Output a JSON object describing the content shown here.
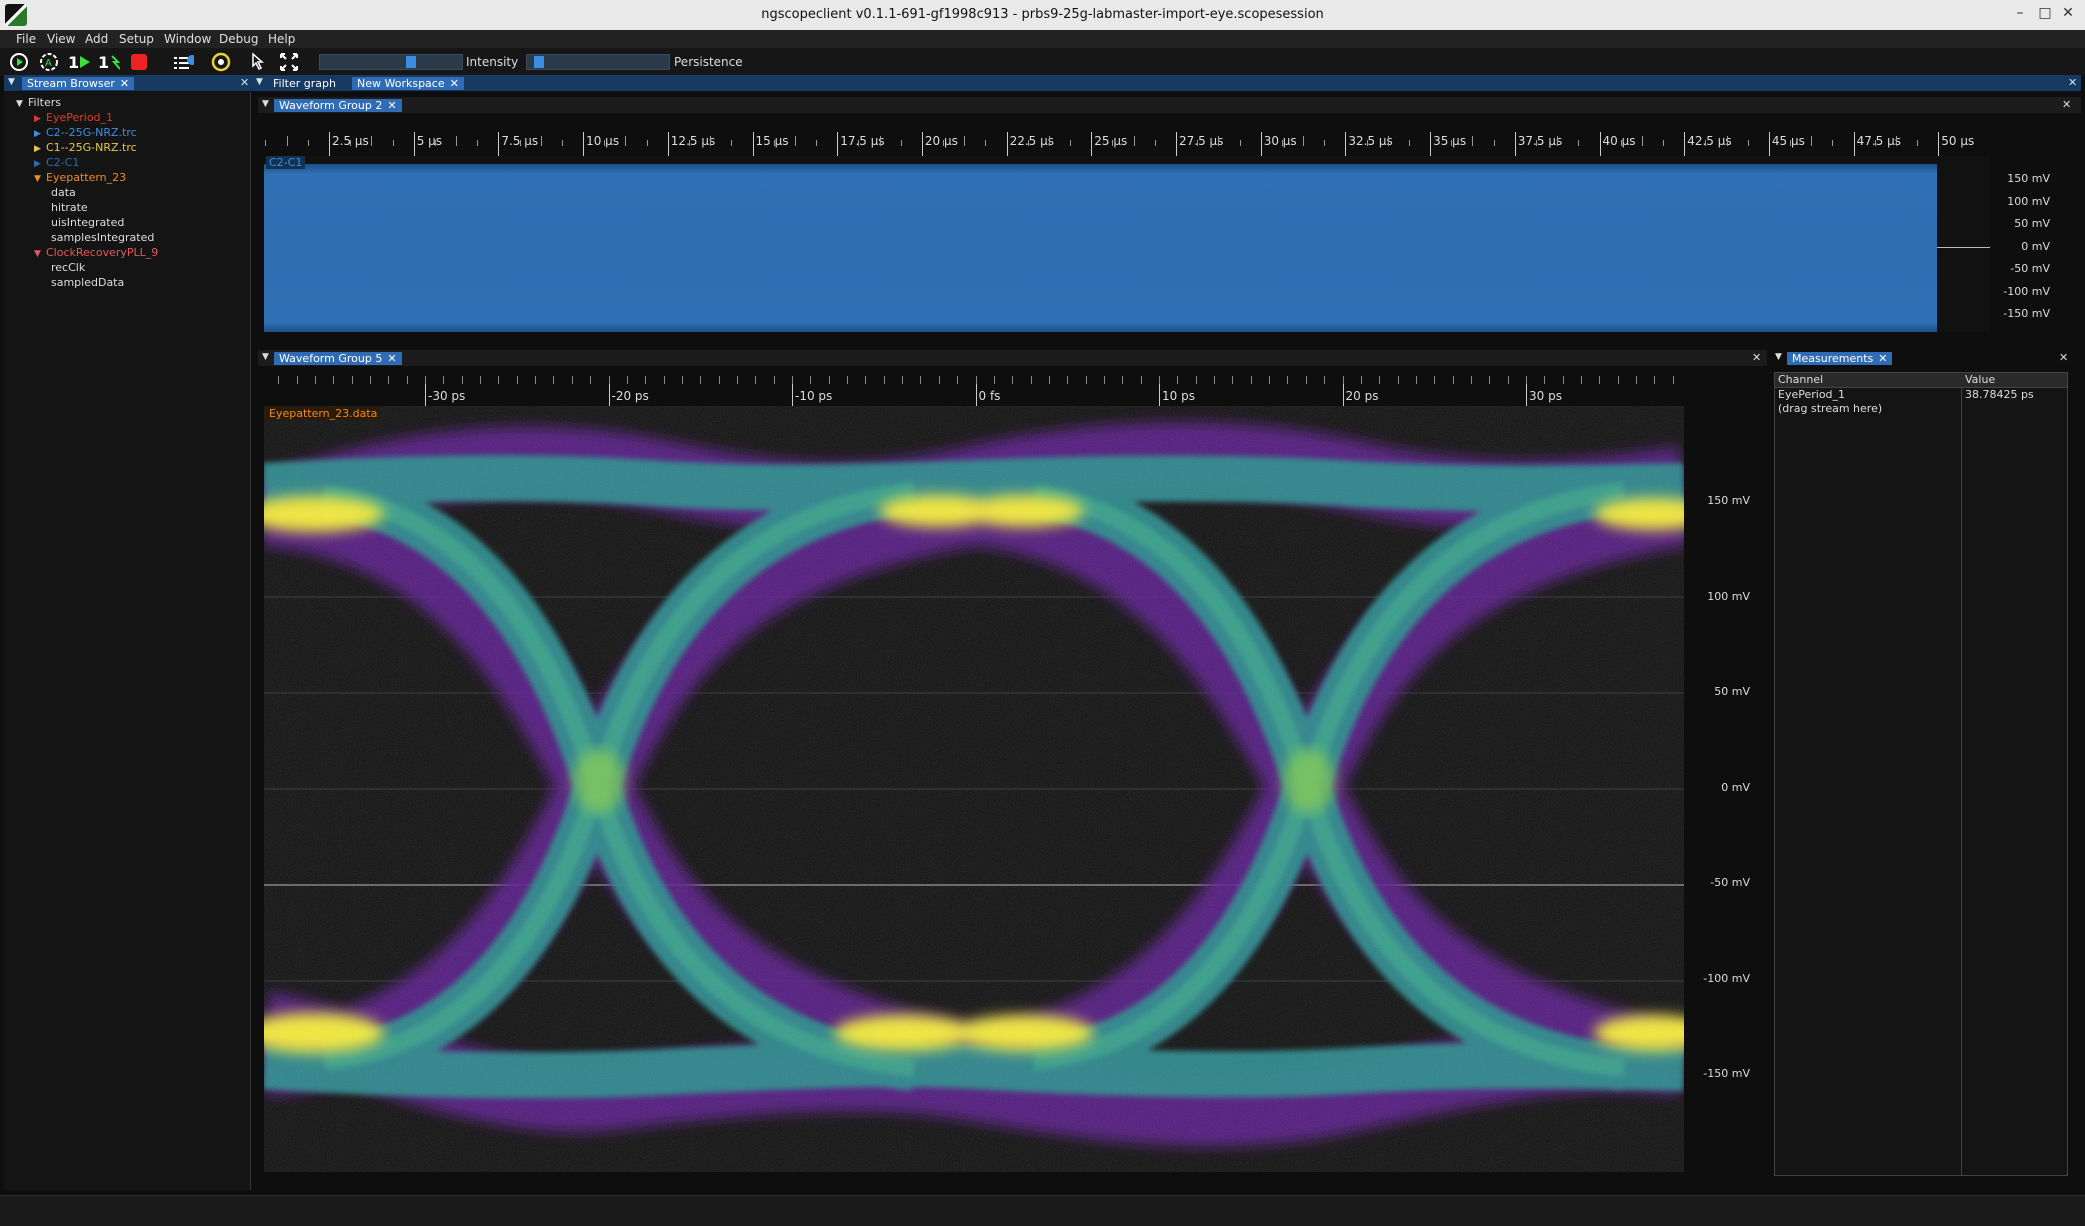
{
  "window": {
    "title": "ngscopeclient v0.1.1-691-gf1998c913  - prbs9-25g-labmaster-import-eye.scopesession",
    "controls": [
      "–",
      "□",
      "✕"
    ]
  },
  "menu": [
    "File",
    "View",
    "Add",
    "Setup",
    "Window",
    "Debug",
    "Help"
  ],
  "toolbar": {
    "intensity_label": "Intensity",
    "intensity_value": 0.65,
    "persistence_label": "Persistence",
    "persistence_value": 0.05,
    "icons": [
      "run-normal-icon",
      "run-auto-icon",
      "single-trigger-icon",
      "force-trigger-icon",
      "stop-icon",
      "timebase-icon",
      "trigger-settings-icon",
      "measure-cursor-icon",
      "fullscreen-icon"
    ]
  },
  "stream_browser": {
    "tab_label": "Stream Browser",
    "root": "Filters",
    "items": [
      {
        "label": "EyePeriod_1",
        "color": "#e03a2e",
        "expanded": false,
        "indent": 1
      },
      {
        "label": "C2--25G-NRZ.trc",
        "color": "#3d8fe0",
        "expanded": false,
        "indent": 1
      },
      {
        "label": "C1--25G-NRZ.trc",
        "color": "#e8c84a",
        "expanded": false,
        "indent": 1
      },
      {
        "label": "C2-C1",
        "color": "#2b6cb5",
        "expanded": false,
        "indent": 1
      },
      {
        "label": "Eyepattern_23",
        "color": "#f08a24",
        "expanded": true,
        "indent": 1
      },
      {
        "label": "data",
        "color": "#dddddd",
        "indent": 2
      },
      {
        "label": "hitrate",
        "color": "#dddddd",
        "indent": 2
      },
      {
        "label": "uisIntegrated",
        "color": "#dddddd",
        "indent": 2
      },
      {
        "label": "samplesIntegrated",
        "color": "#dddddd",
        "indent": 2
      },
      {
        "label": "ClockRecoveryPLL_9",
        "color": "#e05a5a",
        "expanded": true,
        "indent": 1
      },
      {
        "label": "recClk",
        "color": "#dddddd",
        "indent": 2
      },
      {
        "label": "sampledData",
        "color": "#dddddd",
        "indent": 2
      }
    ]
  },
  "workspace_tabs": [
    "Filter graph",
    "New Workspace"
  ],
  "group2": {
    "tab_label": "Waveform Group 2",
    "trace_label": "C2-C1",
    "trace_color": "#3d7fc8",
    "x_ticks": [
      "2.5 µs",
      "5 µs",
      "7.5 µs",
      "10 µs",
      "12.5 µs",
      "15 µs",
      "17.5 µs",
      "20 µs",
      "22.5 µs",
      "25 µs",
      "27.5 µs",
      "30 µs",
      "32.5 µs",
      "35 µs",
      "37.5 µs",
      "40 µs",
      "42.5 µs",
      "45 µs",
      "47.5 µs",
      "50 µs"
    ],
    "y_ticks": [
      "150 mV",
      "100 mV",
      "50 mV",
      "0 mV",
      "-50 mV",
      "-100 mV",
      "-150 mV"
    ]
  },
  "group5": {
    "tab_label": "Waveform Group 5",
    "trace_label": "Eyepattern_23.data",
    "trace_color": "#f08a24",
    "x_ticks": [
      "-30 ps",
      "-20 ps",
      "-10 ps",
      "0 fs",
      "10 ps",
      "20 ps",
      "30 ps"
    ],
    "y_ticks": [
      "150 mV",
      "100 mV",
      "50 mV",
      "0 mV",
      "-50 mV",
      "-100 mV",
      "-150 mV"
    ]
  },
  "measurements": {
    "tab_label": "Measurements",
    "columns": [
      "Channel",
      "Value"
    ],
    "rows": [
      {
        "channel": "EyePeriod_1",
        "value": "38.78425 ps"
      },
      {
        "channel": "(drag stream here)",
        "value": ""
      }
    ]
  }
}
